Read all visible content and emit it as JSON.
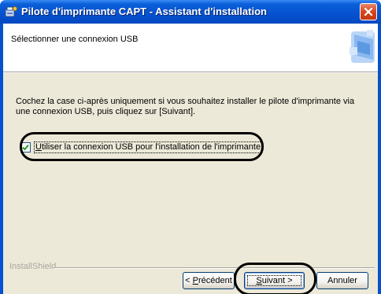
{
  "window": {
    "title": "Pilote d'imprimante CAPT - Assistant d'installation"
  },
  "header": {
    "title": "Sélectionner une connexion USB"
  },
  "body": {
    "instruction": "Cochez la case ci-après uniquement si vous souhaitez installer le pilote d'imprimante via une connexion USB, puis cliquez sur [Suivant].",
    "checkbox": {
      "mnemonic": "U",
      "label_rest": "tiliser la connexion USB pour l'installation de l'imprimante",
      "checked": true
    },
    "installshield": "InstallShield"
  },
  "buttons": {
    "prev_prefix": "< ",
    "prev_mnemonic": "P",
    "prev_rest": "récédent",
    "next_mnemonic": "S",
    "next_rest": "uivant >",
    "cancel": "Annuler"
  },
  "colors": {
    "titlebar": "#0551d0",
    "dialog_bg": "#ece9d8",
    "close_button": "#d6451c"
  }
}
